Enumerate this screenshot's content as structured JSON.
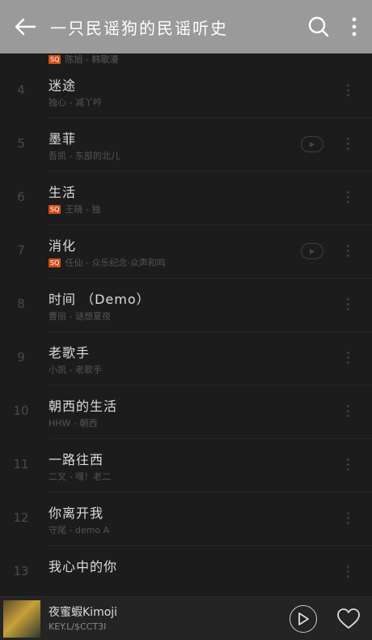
{
  "header": {
    "title": "一只民谣狗的民谣听史"
  },
  "partial_row": {
    "meta": "陈旭 - 韩歌漫"
  },
  "songs": [
    {
      "num": "4",
      "title": "迷途",
      "meta": "独心 - 减丫吟",
      "sq": false,
      "mv": false
    },
    {
      "num": "5",
      "title": "墨菲",
      "meta": "吾凯 - 东部的北儿",
      "sq": false,
      "mv": true
    },
    {
      "num": "6",
      "title": "生活",
      "meta": "王晓 - 独",
      "sq": true,
      "mv": false
    },
    {
      "num": "7",
      "title": "消化",
      "meta": "任仙 - 众乐纪念·众声和鸣",
      "sq": true,
      "mv": true
    },
    {
      "num": "8",
      "title": "时间 （Demo）",
      "meta": "曹丽 - 谜想夏夜",
      "sq": false,
      "mv": false
    },
    {
      "num": "9",
      "title": "老歌手",
      "meta": "小凯 - 老歌手",
      "sq": false,
      "mv": false
    },
    {
      "num": "10",
      "title": "朝西的生活",
      "meta": "HHW - 朝西",
      "sq": false,
      "mv": false
    },
    {
      "num": "11",
      "title": "一路往西",
      "meta": "二叉 - 嘿！老二",
      "sq": false,
      "mv": false
    },
    {
      "num": "12",
      "title": "你离开我",
      "meta": "守尾 - demo A",
      "sq": false,
      "mv": false
    },
    {
      "num": "13",
      "title": "我心中的你",
      "meta": "",
      "sq": false,
      "mv": false
    }
  ],
  "badge_label": "SQ",
  "now_playing": {
    "title": "夜蜜蝦Kimoji",
    "artist": "KEY.L/$CCT3I"
  },
  "icons": {
    "back": "arrow-left-icon",
    "search": "search-icon",
    "menu": "more-vertical-icon",
    "mv": "mv-play-icon",
    "more": "more-vertical-icon",
    "play": "play-icon",
    "favorite": "heart-icon"
  }
}
